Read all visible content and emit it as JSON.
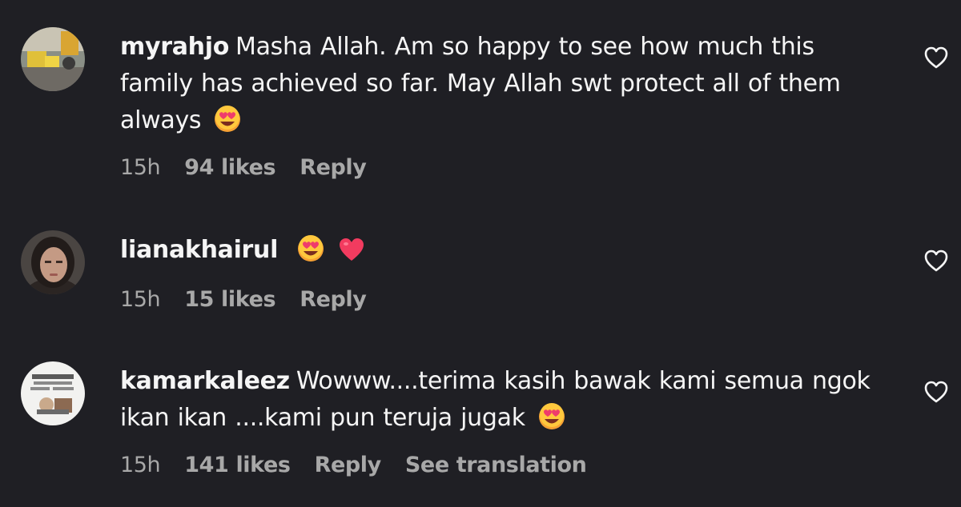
{
  "comments": [
    {
      "username": "myrahjo",
      "text": "Masha Allah. Am so happy to see how much this family has achieved so far. May Allah swt protect all of them always",
      "emojis": [
        "heart-eyes-emoji"
      ],
      "time": "15h",
      "likes": "94 likes",
      "reply": "Reply"
    },
    {
      "username": "lianakhairul",
      "text": "",
      "emojis": [
        "heart-eyes-emoji",
        "red-heart-emoji"
      ],
      "time": "15h",
      "likes": "15 likes",
      "reply": "Reply"
    },
    {
      "username": "kamarkaleez",
      "text": "Wowww....terima kasih bawak kami semua ngok ikan ikan ....kami pun teruja jugak",
      "emojis": [
        "heart-eyes-emoji"
      ],
      "time": "15h",
      "likes": "141 likes",
      "reply": "Reply",
      "see_translation": "See translation"
    }
  ],
  "colors": {
    "background": "#1f1f24",
    "text": "#f5f5f5",
    "meta": "#a8a8a8"
  }
}
